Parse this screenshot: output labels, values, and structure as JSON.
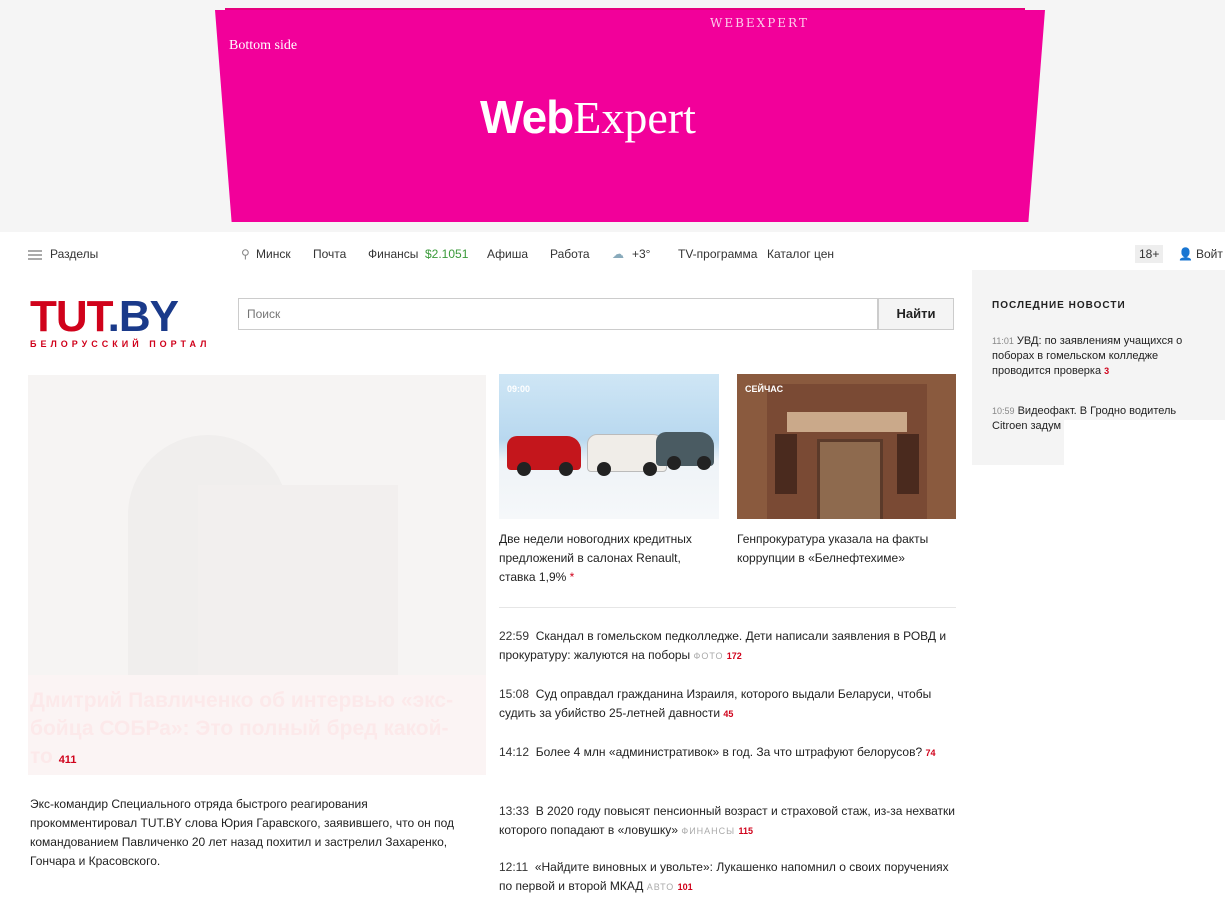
{
  "banner": {
    "top_text": "WEBEXPERT",
    "label": "Bottom side",
    "logo_bold": "Web",
    "logo_light": "Expert"
  },
  "nav": {
    "sections": "Разделы",
    "city": "Минск",
    "mail": "Почта",
    "finance": "Финансы",
    "finance_value": "$2.1051",
    "afisha": "Афиша",
    "work": "Работа",
    "weather": "+3°",
    "tv": "TV-программа",
    "prices": "Каталог цен",
    "age": "18+",
    "login": "Войт"
  },
  "logo": {
    "part1": "TUT",
    "part2": ".BY",
    "subtitle": "БЕЛОРУССКИЙ ПОРТАЛ"
  },
  "search": {
    "placeholder": "Поиск",
    "button": "Найти"
  },
  "lead": {
    "title": "Дмитрий Павличенко об интервью «экс-бойца СОБРа»: Это полный бред какой-то",
    "count": "411",
    "text": "Экс-командир Специального отряда быстрого реагирования прокомментировал TUT.BY слова Юрия Гаравского, заявившего, что он под командованием Павличенко 20 лет назад похитил и застрелил Захаренко, Гончара и Красовского."
  },
  "cards": [
    {
      "badge": "09:00",
      "caption": "Две недели новогодних кредитных предложений в салонах Renault, ставка 1,9%",
      "mark": "*"
    },
    {
      "badge": "СЕЙЧАС",
      "caption": "Генпрокуратура указала на факты коррупции в «Белнефтехиме»"
    }
  ],
  "news": [
    {
      "time": "22:59",
      "title": "Скандал в гомельском педколледже. Дети написали заявления в РОВД и прокуратуру: жалуются на поборы",
      "category": "ФОТО",
      "count": "172"
    },
    {
      "time": "15:08",
      "title": "Суд оправдал гражданина Израиля, которого выдали Беларуси, чтобы судить за убийство 25-летней давности",
      "category": "",
      "count": "45"
    },
    {
      "time": "14:12",
      "title": "Более 4 млн «административок» в год. За что штрафуют белорусов?",
      "category": "",
      "count": "74"
    },
    {
      "time": "13:33",
      "title": "В 2020 году повысят пенсионный возраст и страховой стаж, из-за нехватки которого попадают в «ловушку»",
      "category": "ФИНАНСЫ",
      "count": "115"
    },
    {
      "time": "12:11",
      "title": "«Найдите виновных и увольте»: Лукашенко напомнил о своих поручениях по первой и второй МКАД",
      "category": "АВТО",
      "count": "101"
    }
  ],
  "sidebar": {
    "title": "ПОСЛЕДНИЕ НОВОСТИ",
    "items": [
      {
        "time": "11:01",
        "title": "УВД: по заявлениям учащихся о поборах в гомельском колледже проводится проверка",
        "count": "3"
      },
      {
        "time": "10:59",
        "title": "Видеофакт. В Гродно водитель Citroen задум и врезался в",
        "count": ""
      }
    ]
  },
  "colors": {
    "banner": "#f2009a",
    "brand_red": "#d0021b",
    "brand_blue": "#1a3a8a"
  }
}
